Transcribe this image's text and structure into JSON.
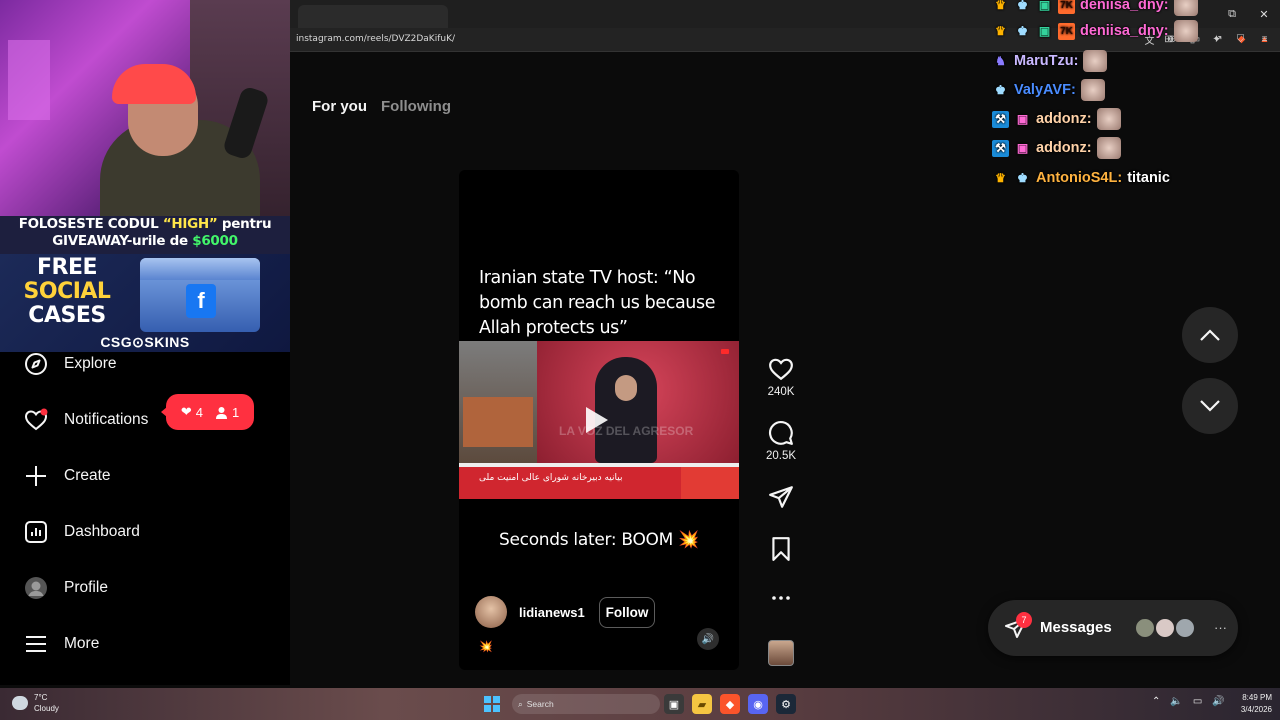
{
  "browser": {
    "url": "instagram.com/reels/DVZ2DaKifuK/",
    "window_controls": [
      "restore",
      "close"
    ]
  },
  "ig": {
    "tabs": [
      {
        "label": "For you",
        "active": true
      },
      {
        "label": "Following",
        "active": false
      }
    ],
    "sidebar": {
      "items": [
        {
          "label": "Explore",
          "icon": "compass-icon"
        },
        {
          "label": "Notifications",
          "icon": "heart-icon"
        },
        {
          "label": "Create",
          "icon": "plus-icon"
        },
        {
          "label": "Dashboard",
          "icon": "bar-chart-icon"
        },
        {
          "label": "Profile",
          "icon": "profile-avatar"
        },
        {
          "label": "More",
          "icon": "menu-icon"
        }
      ],
      "notification_pill": {
        "likes": "4",
        "follows": "1"
      }
    },
    "reel": {
      "top_caption": "Iranian state TV host: “No bomb can reach us because Allah protects us”",
      "bottom_caption": "Seconds later: BOOM 💥",
      "clip_watermark": "LA VOZ DEL AGRESOR",
      "ticker_text": "بیانیه دبیرخانه شورای عالی امنیت ملی",
      "author": "lidianews1",
      "follow_label": "Follow",
      "spark": "💥",
      "likes": "240K",
      "comments": "20.5K"
    },
    "messages": {
      "label": "Messages",
      "badge": "7"
    }
  },
  "stream": {
    "promo_line1_pre": "FOLOSESTE CODUL ",
    "promo_code": "“HIGH”",
    "promo_line1_post": " pentru",
    "promo_line2_pre": "GIVEAWAY-urile de ",
    "promo_amount": "$6000",
    "banner_line1": "FREE",
    "banner_line2": "SOCIAL",
    "banner_line3": "CASES",
    "banner_brand": "CSG⊙SKINS",
    "chat": [
      {
        "user": "deniisa_dny:",
        "color": "#ff6ad5",
        "message": ""
      },
      {
        "user": "deniisa_dny:",
        "color": "#ff6ad5",
        "message": ""
      },
      {
        "user": "MaruTzu:",
        "color": "#c9b8ff",
        "message": ""
      },
      {
        "user": "ValyAVF:",
        "color": "#4a8cff",
        "message": ""
      },
      {
        "user": "addonz:",
        "color": "#ffd2a8",
        "message": ""
      },
      {
        "user": "addonz:",
        "color": "#ffd2a8",
        "message": ""
      },
      {
        "user": "AntonioS4L:",
        "color": "#ffb340",
        "message": "titanic"
      }
    ]
  },
  "taskbar": {
    "temperature": "7°C",
    "weather": "Cloudy",
    "search_label": "Search",
    "time": "8:49 PM",
    "date": "3/4/2026"
  }
}
